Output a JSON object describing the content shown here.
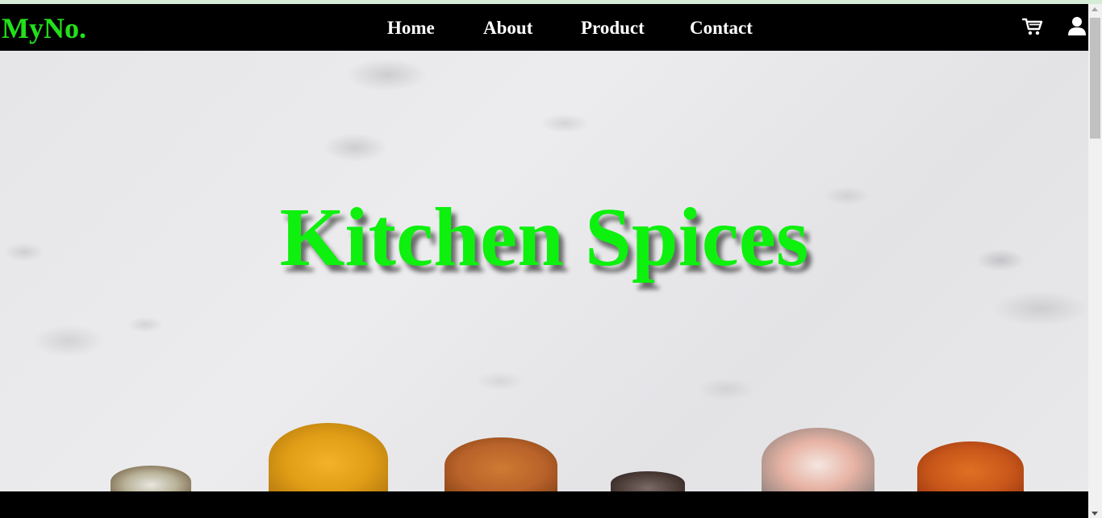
{
  "brand": {
    "name": "MyNo."
  },
  "nav": {
    "items": [
      {
        "label": "Home"
      },
      {
        "label": "About"
      },
      {
        "label": "Product"
      },
      {
        "label": "Contact"
      }
    ],
    "icons": [
      "cart-icon",
      "user-icon"
    ]
  },
  "hero": {
    "title": "Kitchen Spices"
  },
  "colors": {
    "brand_green": "#23e01a",
    "title_green": "#0ef00e",
    "nav_bg": "#000000",
    "nav_text": "#ffffff"
  }
}
